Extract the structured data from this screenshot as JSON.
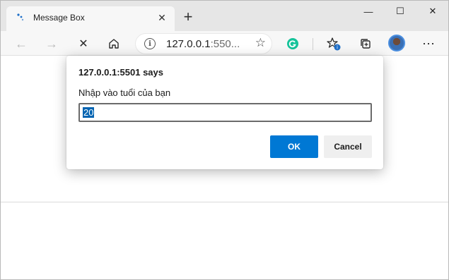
{
  "browser": {
    "tab": {
      "title": "Message Box",
      "favicon": "loading-dots-icon"
    },
    "new_tab_icon": "+",
    "window_controls": {
      "minimize": "—",
      "maximize": "☐",
      "close": "✕"
    },
    "toolbar": {
      "back_icon": "←",
      "forward_icon": "→",
      "stop_icon": "✕",
      "home_icon": "home-icon",
      "address": {
        "host": "127.0.0.1",
        "rest": ":550...",
        "info_icon": "i"
      },
      "favorite_icon": "☆",
      "more_icon": "⋯"
    }
  },
  "dialog": {
    "title": "127.0.0.1:5501 says",
    "message": "Nhập vào tuổi của bạn",
    "input_value": "20",
    "ok_label": "OK",
    "cancel_label": "Cancel"
  },
  "colors": {
    "accent": "#0078d4",
    "selection": "#0063b1",
    "tabstrip": "#e6e6e6",
    "toolbar": "#f7f7f7"
  }
}
